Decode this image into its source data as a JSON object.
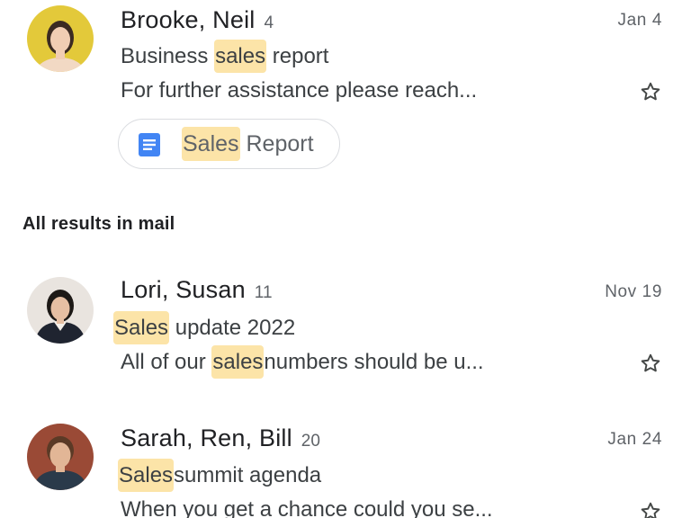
{
  "threads_top": [
    {
      "sender": "Brooke, Neil",
      "count": "4",
      "date": "Jan 4",
      "subject_parts": [
        "Business ",
        "sales",
        " report"
      ],
      "snippet": "For further assistance please reach...",
      "attachment": {
        "icon": "google-docs-icon",
        "label_parts": [
          "Sales",
          " Report"
        ]
      }
    }
  ],
  "section_heading": "All results in mail",
  "threads": [
    {
      "sender": "Lori, Susan",
      "count": "11",
      "date": "Nov 19",
      "subject_parts": [
        "Sales",
        " update 2022"
      ],
      "snippet_parts": [
        "All of our ",
        "sales",
        "numbers should be u..."
      ]
    },
    {
      "sender": "Sarah, Ren, Bill",
      "count": "20",
      "date": "Jan 24",
      "subject_parts": [
        "Sales",
        "summit agenda"
      ],
      "snippet": "When you get a chance could you se..."
    }
  ],
  "icons": {
    "star": "star-outline-icon",
    "doc": "google-docs-icon"
  },
  "colors": {
    "highlight": "#fce4a8",
    "doc_blue": "#4285f4",
    "avatar_1_bg": "#e3c93a",
    "avatar_2_bg": "#e9e4df",
    "avatar_3_bg": "#9a4a36"
  }
}
